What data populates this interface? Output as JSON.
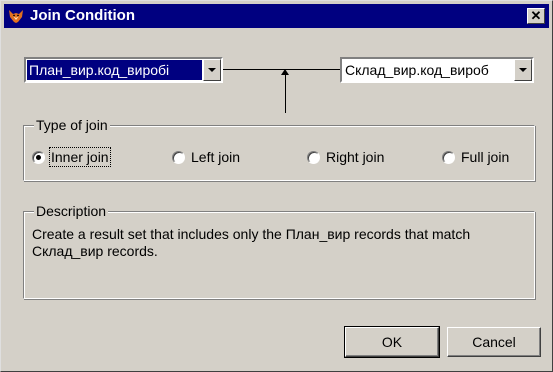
{
  "window": {
    "title": "Join Condition",
    "close_label": "✕"
  },
  "left_field": {
    "value": "План_вир.код_виробі"
  },
  "right_field": {
    "value": "Склад_вир.код_вироб"
  },
  "join_type": {
    "label": "Type of join",
    "options": [
      {
        "label": "Inner join",
        "checked": true
      },
      {
        "label": "Left join",
        "checked": false
      },
      {
        "label": "Right join",
        "checked": false
      },
      {
        "label": "Full join",
        "checked": false
      }
    ]
  },
  "description": {
    "label": "Description",
    "line1": "Create a result set that includes only the План_вир records that match",
    "line2": "Склад_вир records."
  },
  "buttons": {
    "ok": "OK",
    "cancel": "Cancel"
  }
}
